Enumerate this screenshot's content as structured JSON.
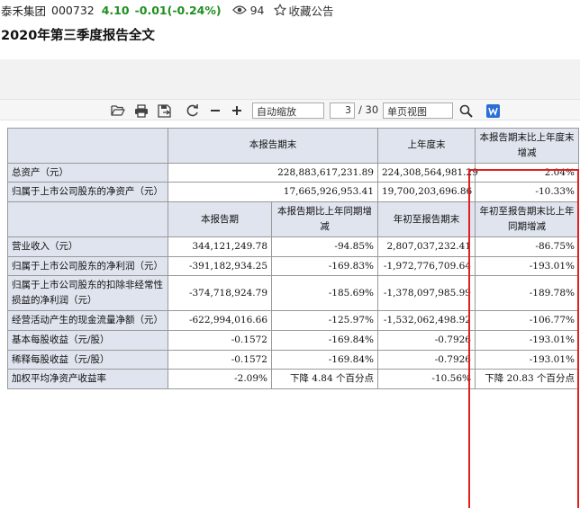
{
  "stock": {
    "name": "泰禾集团",
    "code": "000732",
    "price": "4.10",
    "change": "-0.01(-0.24%)",
    "views": "94",
    "favorite_label": "收藏公告",
    "price_color": "#1e8f1e"
  },
  "document": {
    "title": "2020年第三季度报告全文"
  },
  "toolbar": {
    "icons": [
      "open-file-icon",
      "print-icon",
      "save-icon",
      "rotate-icon",
      "zoom-out-icon",
      "zoom-in-icon",
      "search-icon",
      "word-icon"
    ],
    "zoom_value": "自动缩放",
    "page_current": "3",
    "page_total": "/ 30",
    "view_mode": "单页视图"
  },
  "table": {
    "header1": {
      "col_current": "本报告期末",
      "col_last_year_end": "上年度末",
      "col_change": "本报告期末比上年度末增减"
    },
    "top_rows": [
      {
        "label": "总资产（元）",
        "current": "228,883,617,231.89",
        "last_year_end": "224,308,564,981.29",
        "change": "2.04%"
      },
      {
        "label": "归属于上市公司股东的净资产（元）",
        "current": "17,665,926,953.41",
        "last_year_end": "19,700,203,696.86",
        "change": "-10.33%"
      }
    ],
    "header2": {
      "col_period": "本报告期",
      "col_period_yoy": "本报告期比上年同期增减",
      "col_ytd": "年初至报告期末",
      "col_ytd_yoy": "年初至报告期末比上年同期增减"
    },
    "rows": [
      {
        "label": "营业收入（元）",
        "period": "344,121,249.78",
        "period_yoy": "-94.85%",
        "ytd": "2,807,037,232.41",
        "ytd_yoy": "-86.75%"
      },
      {
        "label": "归属于上市公司股东的净利润（元）",
        "period": "-391,182,934.25",
        "period_yoy": "-169.83%",
        "ytd": "-1,972,776,709.64",
        "ytd_yoy": "-193.01%"
      },
      {
        "label": "归属于上市公司股东的扣除非经常性损益的净利润（元）",
        "period": "-374,718,924.79",
        "period_yoy": "-185.69%",
        "ytd": "-1,378,097,985.99",
        "ytd_yoy": "-189.78%"
      },
      {
        "label": "经营活动产生的现金流量净额（元）",
        "period": "-622,994,016.66",
        "period_yoy": "-125.97%",
        "ytd": "-1,532,062,498.92",
        "ytd_yoy": "-106.77%"
      },
      {
        "label": "基本每股收益（元/股）",
        "period": "-0.1572",
        "period_yoy": "-169.84%",
        "ytd": "-0.7926",
        "ytd_yoy": "-193.01%"
      },
      {
        "label": "稀释每股收益（元/股）",
        "period": "-0.1572",
        "period_yoy": "-169.84%",
        "ytd": "-0.7926",
        "ytd_yoy": "-193.01%"
      },
      {
        "label": "加权平均净资产收益率",
        "period": "-2.09%",
        "period_yoy": "下降 4.84 个百分点",
        "ytd": "-10.56%",
        "ytd_yoy": "下降 20.83 个百分点"
      }
    ],
    "highlight_color": "#e02020"
  }
}
